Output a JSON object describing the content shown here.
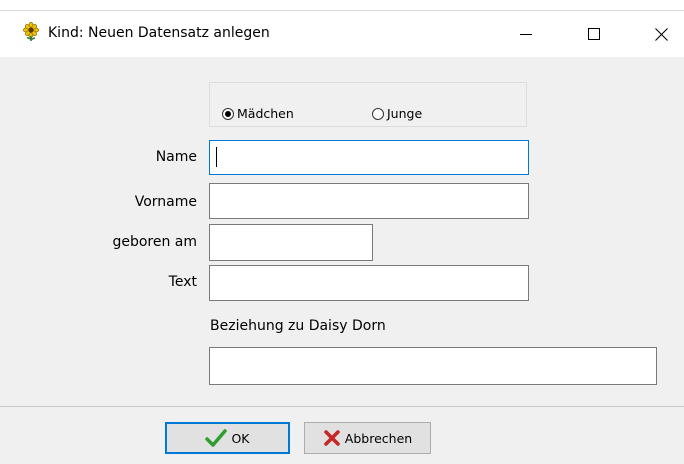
{
  "window": {
    "title": "Kind: Neuen Datensatz anlegen",
    "icon": "flower-app-icon",
    "controls": [
      "minimize-icon",
      "maximize-icon",
      "close-icon"
    ]
  },
  "gender": {
    "options": [
      {
        "label": "Mädchen",
        "checked": true
      },
      {
        "label": "Junge",
        "checked": false
      }
    ]
  },
  "form": {
    "name_label": "Name",
    "name_value": "",
    "vorname_label": "Vorname",
    "vorname_value": "",
    "geboren_label": "geboren am",
    "geboren_value": "",
    "text_label": "Text",
    "text_value": "",
    "beziehung_label": "Beziehung zu Daisy Dorn",
    "beziehung_value": ""
  },
  "buttons": {
    "ok_label": "OK",
    "ok_icon": "checkmark-icon",
    "ok_color": "#2e9e2e",
    "cancel_label": "Abbrechen",
    "cancel_icon": "cross-icon",
    "cancel_color": "#c62828"
  },
  "colors": {
    "focus": "#0078d7",
    "client_bg": "#f0f0f0"
  }
}
